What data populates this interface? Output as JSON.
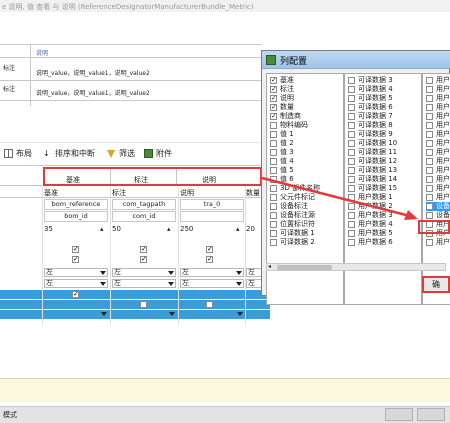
{
  "topbar": {
    "text": "e 说明, 值 查看 与 说明 (ReferenceDesignatorManufacturerBundle_Metric)"
  },
  "notes": {
    "header": "说明",
    "rows": [
      {
        "label": "标注",
        "value": "说明_value，说明_value1，说明_value2"
      },
      {
        "label": "标注",
        "value": "说明_value，说明_value1，说明_value2"
      }
    ]
  },
  "toolbar": {
    "layout": "布局",
    "sort": "排序和中断",
    "filter": "筛选",
    "attach": "附件"
  },
  "grid": {
    "group_headers": [
      "基准",
      "标注",
      "说明"
    ],
    "col_headers": [
      "基准",
      "标注",
      "说明",
      "数量"
    ],
    "field_row1": [
      "bom_reference",
      "com_tagpath",
      "tra_0"
    ],
    "field_row2": [
      "bom_id",
      "com_id",
      ""
    ],
    "widths": [
      "35",
      "50",
      "250",
      "20"
    ],
    "align": [
      "左",
      "左",
      "左",
      "左"
    ]
  },
  "dialog": {
    "title": "列配置",
    "col1": [
      {
        "label": "基准",
        "checked": true
      },
      {
        "label": "标注",
        "checked": true
      },
      {
        "label": "说明",
        "checked": true
      },
      {
        "label": "数量",
        "checked": true
      },
      {
        "label": "制造商",
        "checked": true
      },
      {
        "label": "物料编码",
        "checked": false
      },
      {
        "label": "值 1",
        "checked": false
      },
      {
        "label": "值 2",
        "checked": false
      },
      {
        "label": "值 3",
        "checked": false
      },
      {
        "label": "值 4",
        "checked": false
      },
      {
        "label": "值 5",
        "checked": false
      },
      {
        "label": "值 6",
        "checked": false
      },
      {
        "label": "3D 部件名称",
        "checked": false
      },
      {
        "label": "父元件标记",
        "checked": false
      },
      {
        "label": "设备标注",
        "checked": false
      },
      {
        "label": "设备标注源",
        "checked": false
      },
      {
        "label": "位置标识符",
        "checked": false
      },
      {
        "label": "可译数据 1",
        "checked": false
      },
      {
        "label": "可译数据 2",
        "checked": false
      }
    ],
    "col2": [
      {
        "label": "可译数据 3",
        "checked": false
      },
      {
        "label": "可译数据 4",
        "checked": false
      },
      {
        "label": "可译数据 5",
        "checked": false
      },
      {
        "label": "可译数据 6",
        "checked": false
      },
      {
        "label": "可译数据 7",
        "checked": false
      },
      {
        "label": "可译数据 8",
        "checked": false
      },
      {
        "label": "可译数据 9",
        "checked": false
      },
      {
        "label": "可译数据 10",
        "checked": false
      },
      {
        "label": "可译数据 11",
        "checked": false
      },
      {
        "label": "可译数据 12",
        "checked": false
      },
      {
        "label": "可译数据 13",
        "checked": false
      },
      {
        "label": "可译数据 14",
        "checked": false
      },
      {
        "label": "可译数据 15",
        "checked": false
      },
      {
        "label": "用户数据 1",
        "checked": false
      },
      {
        "label": "用户数据 2",
        "checked": false
      },
      {
        "label": "用户数据 3",
        "checked": false
      },
      {
        "label": "用户数据 4",
        "checked": false
      },
      {
        "label": "用户数据 5",
        "checked": false
      },
      {
        "label": "用户数据 6",
        "checked": false
      }
    ],
    "col3": [
      {
        "label": "用户",
        "checked": false
      },
      {
        "label": "用户",
        "checked": false
      },
      {
        "label": "用户",
        "checked": false
      },
      {
        "label": "用户",
        "checked": false
      },
      {
        "label": "用户",
        "checked": false
      },
      {
        "label": "用户",
        "checked": false
      },
      {
        "label": "用户",
        "checked": false
      },
      {
        "label": "用户",
        "checked": false
      },
      {
        "label": "用户",
        "checked": false
      },
      {
        "label": "用户",
        "checked": false
      },
      {
        "label": "用户",
        "checked": false
      },
      {
        "label": "用户",
        "checked": false
      },
      {
        "label": "用户",
        "checked": false
      },
      {
        "label": "用户",
        "checked": false
      },
      {
        "label": "设备",
        "checked": true,
        "selected": true
      },
      {
        "label": "设备",
        "checked": false
      },
      {
        "label": "用户",
        "checked": false
      },
      {
        "label": "用户",
        "checked": false
      },
      {
        "label": "用户",
        "checked": false
      }
    ],
    "ok_label": "确"
  },
  "bottombar": {
    "text": "模式"
  },
  "colors": {
    "accent_red": "#e23a3a",
    "row_blue": "#3a9dd9",
    "selection": "#3399ff"
  }
}
